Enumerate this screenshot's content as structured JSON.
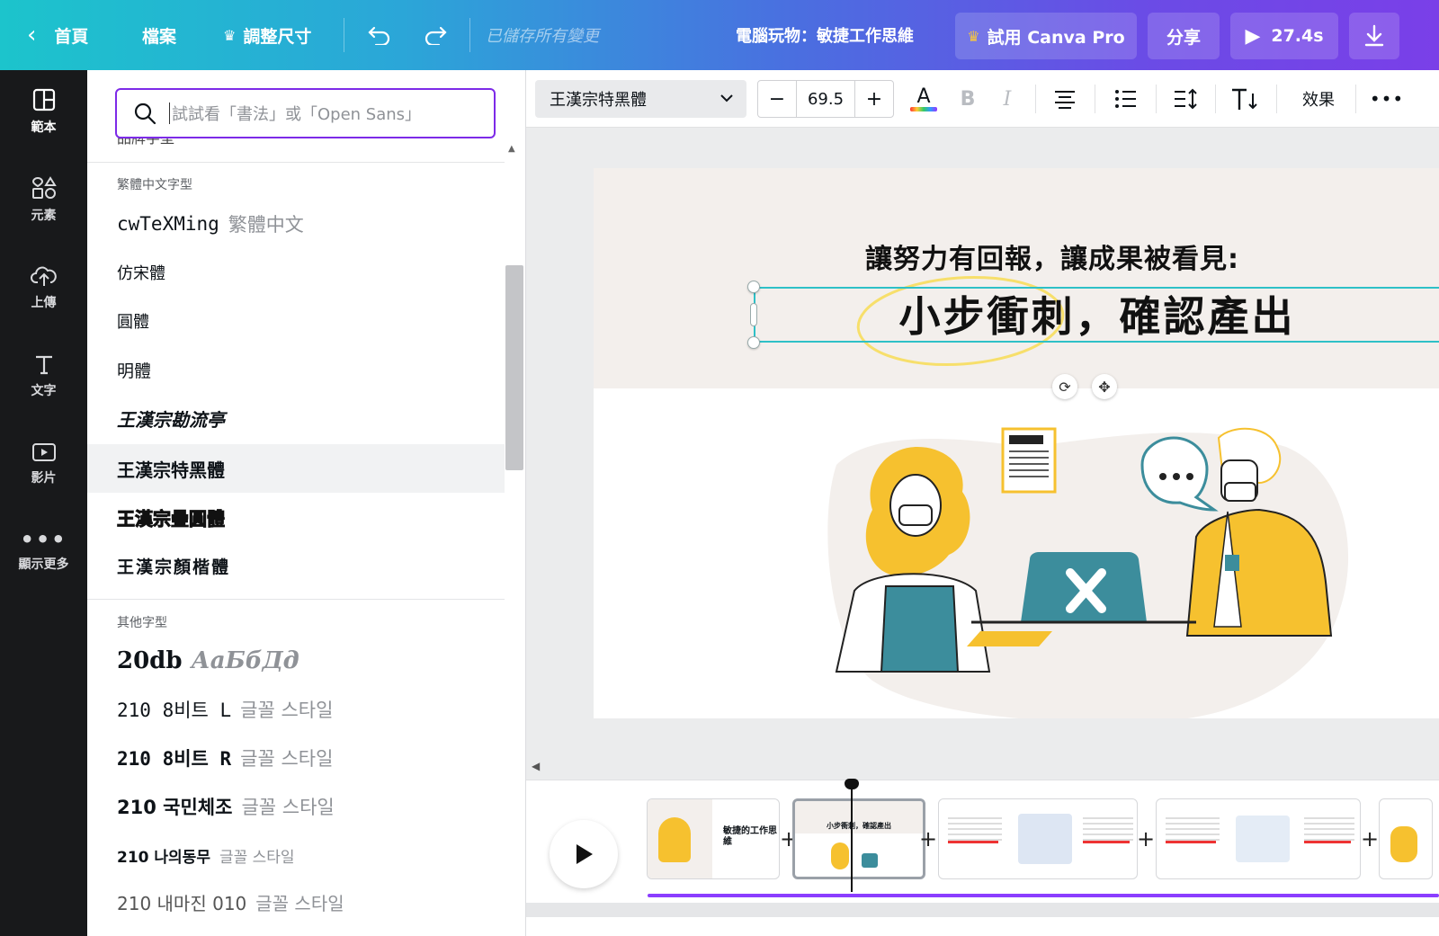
{
  "topbar": {
    "home": "首頁",
    "file": "檔案",
    "resize": "調整尺寸",
    "saved_status": "已儲存所有變更",
    "doc_title": "電腦玩物：敏捷工作思維",
    "try_pro": "試用 Canva Pro",
    "share": "分享",
    "duration": "27.4s"
  },
  "sidebar": {
    "items": [
      {
        "label": "範本",
        "icon": "template-icon"
      },
      {
        "label": "元素",
        "icon": "elements-icon"
      },
      {
        "label": "上傳",
        "icon": "upload-icon"
      },
      {
        "label": "文字",
        "icon": "text-icon"
      },
      {
        "label": "影片",
        "icon": "video-icon"
      },
      {
        "label": "顯示更多",
        "icon": "more-icon"
      }
    ]
  },
  "panel": {
    "search_placeholder": "試試看「書法」或「Open Sans」",
    "partial_top_label": "品牌字型",
    "section_trad_chinese": "繁體中文字型",
    "trad_fonts": [
      {
        "name": "cwTeXMing",
        "preview": "繁體中文"
      },
      {
        "name": "仿宋體",
        "preview": ""
      },
      {
        "name": "圓體",
        "preview": ""
      },
      {
        "name": "明體",
        "preview": ""
      },
      {
        "name": "王漢宗勘流亭",
        "preview": ""
      },
      {
        "name": "王漢宗特黑體",
        "preview": ""
      },
      {
        "name": "王漢宗疊圓體",
        "preview": ""
      },
      {
        "name": "王漢宗顏楷體",
        "preview": ""
      }
    ],
    "section_other": "其他字型",
    "other_fonts": [
      {
        "name": "20db",
        "preview": "АаБбДд"
      },
      {
        "name": "210 8비트 L",
        "preview": "글꼴 스타일"
      },
      {
        "name": "210 8비트 R",
        "preview": "글꼴 스타일"
      },
      {
        "name": "210 국민체조",
        "preview": "글꼴 스타일"
      },
      {
        "name": "210 나의동무",
        "preview": "글꼴 스타일"
      },
      {
        "name": "210 내마진 010",
        "preview": "글꼴 스타일"
      }
    ]
  },
  "toolbar": {
    "font_name": "王漢宗特黑體",
    "font_size": "69.5",
    "effects": "效果",
    "minus": "−",
    "plus": "+"
  },
  "canvas": {
    "subtitle": "讓努力有回報，讓成果被看見:",
    "headline": "小步衝刺，確認產出"
  },
  "timeline": {
    "thumb1_title": "敏捷的工作思維",
    "thumb2_text": "小步衝刺，確認產出"
  },
  "colors": {
    "accent_purple": "#7d2ae8",
    "selection_teal": "#2ec0c7",
    "illustration_yellow": "#f6c12f",
    "illustration_teal": "#3c8d9c"
  }
}
